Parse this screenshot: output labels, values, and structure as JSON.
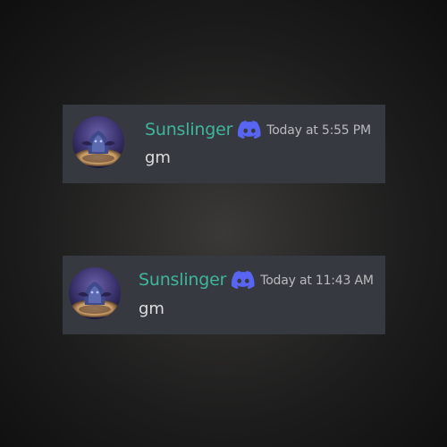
{
  "messages": [
    {
      "username": "Sunslinger",
      "timestamp": "Today at 5:55 PM",
      "content": "gm",
      "badge_icon": "discord-logo-icon"
    },
    {
      "username": "Sunslinger",
      "timestamp": "Today at 11:43 AM",
      "content": "gm",
      "badge_icon": "discord-logo-icon"
    }
  ],
  "colors": {
    "card_background": "#36393f",
    "username": "#3fb69a",
    "timestamp": "#b9bbbe",
    "message_text": "#dcddde",
    "badge": "#5865f2"
  }
}
